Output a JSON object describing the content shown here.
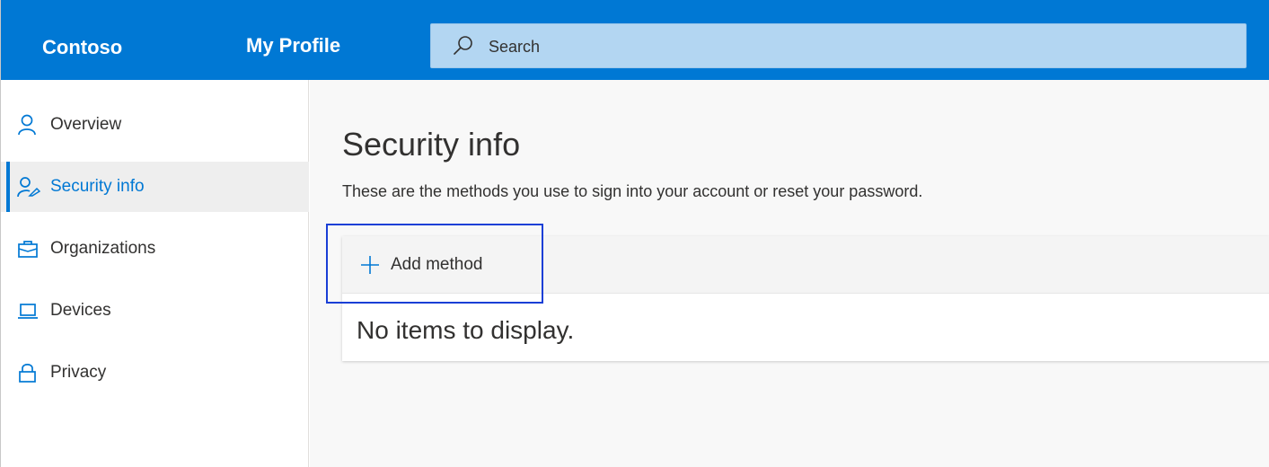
{
  "header": {
    "brand": "Contoso",
    "app_name": "My Profile",
    "search": {
      "placeholder": "Search",
      "icon": "search-icon"
    },
    "accent_color": "#0078d4"
  },
  "sidebar": {
    "items": [
      {
        "label": "Overview",
        "icon": "person-icon",
        "active": false
      },
      {
        "label": "Security info",
        "icon": "person-key-icon",
        "active": true
      },
      {
        "label": "Organizations",
        "icon": "briefcase-icon",
        "active": false
      },
      {
        "label": "Devices",
        "icon": "laptop-icon",
        "active": false
      },
      {
        "label": "Privacy",
        "icon": "lock-icon",
        "active": false
      }
    ]
  },
  "main": {
    "title": "Security info",
    "description": "These are the methods you use to sign into your account or reset your password.",
    "toolbar": {
      "add_label": "Add method",
      "icon": "plus-icon"
    },
    "empty_message": "No items to display."
  },
  "annotation": {
    "highlight_color": "#1a3fd6"
  }
}
